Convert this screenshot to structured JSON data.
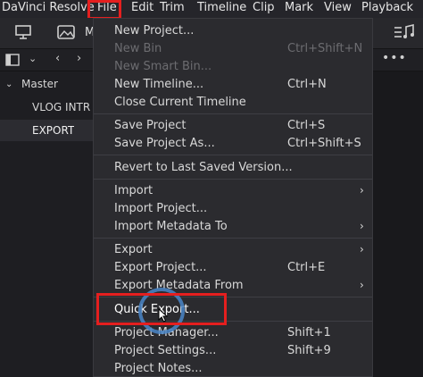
{
  "menubar": {
    "items": [
      {
        "label": "DaVinci Resolve"
      },
      {
        "label": "File"
      },
      {
        "label": "Edit"
      },
      {
        "label": "Trim"
      },
      {
        "label": "Timeline"
      },
      {
        "label": "Clip"
      },
      {
        "label": "Mark"
      },
      {
        "label": "View"
      },
      {
        "label": "Playback"
      }
    ]
  },
  "toolbar": {
    "media_label": "M"
  },
  "media_pool": {
    "items": [
      {
        "label": "Master",
        "expanded": true
      },
      {
        "label": "VLOG INTR"
      },
      {
        "label": "EXPORT",
        "selected": true
      }
    ]
  },
  "file_menu": {
    "items": [
      {
        "label": "New Project...",
        "shortcut": "",
        "enabled": true
      },
      {
        "label": "New Bin",
        "shortcut": "Ctrl+Shift+N",
        "enabled": false
      },
      {
        "label": "New Smart Bin...",
        "shortcut": "",
        "enabled": false
      },
      {
        "label": "New Timeline...",
        "shortcut": "Ctrl+N",
        "enabled": true
      },
      {
        "label": "Close Current Timeline",
        "shortcut": "",
        "enabled": true
      },
      {
        "label": "Save Project",
        "shortcut": "Ctrl+S",
        "enabled": true
      },
      {
        "label": "Save Project As...",
        "shortcut": "Ctrl+Shift+S",
        "enabled": true
      },
      {
        "label": "Revert to Last Saved Version...",
        "shortcut": "",
        "enabled": true
      },
      {
        "label": "Import",
        "shortcut": "",
        "enabled": true,
        "submenu": true
      },
      {
        "label": "Import Project...",
        "shortcut": "",
        "enabled": true
      },
      {
        "label": "Import Metadata To",
        "shortcut": "",
        "enabled": true,
        "submenu": true
      },
      {
        "label": "Export",
        "shortcut": "",
        "enabled": true,
        "submenu": true
      },
      {
        "label": "Export Project...",
        "shortcut": "Ctrl+E",
        "enabled": true
      },
      {
        "label": "Export Metadata From",
        "shortcut": "",
        "enabled": true,
        "submenu": true
      },
      {
        "label": "Quick Export...",
        "shortcut": "",
        "enabled": true
      },
      {
        "label": "Project Manager...",
        "shortcut": "Shift+1",
        "enabled": true
      },
      {
        "label": "Project Settings...",
        "shortcut": "Shift+9",
        "enabled": true
      },
      {
        "label": "Project Notes...",
        "shortcut": "",
        "enabled": true
      }
    ]
  },
  "colors": {
    "highlight": "#e51f1f",
    "cursor_ring": "#4a86c8",
    "menu_bg": "#2b2b2f"
  }
}
